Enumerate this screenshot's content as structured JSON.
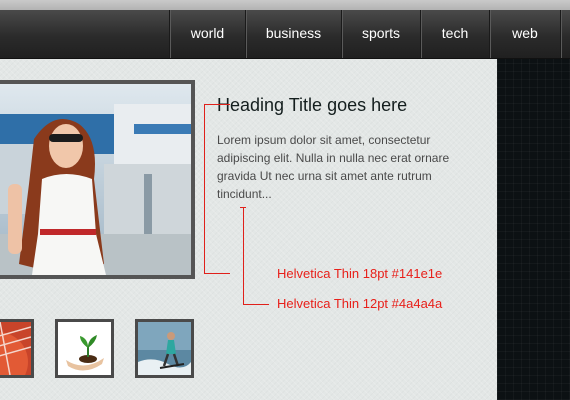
{
  "nav": {
    "items": [
      {
        "label": "world"
      },
      {
        "label": "business"
      },
      {
        "label": "sports"
      },
      {
        "label": "tech"
      },
      {
        "label": "web"
      },
      {
        "label": ""
      }
    ]
  },
  "article": {
    "heading": "Heading Title goes here",
    "body": "Lorem ipsum dolor sit amet, consectetur adipiscing elit. Nulla in nulla nec erat ornare gravida Ut nec urna sit amet ante rutrum tincidunt..."
  },
  "annotations": {
    "heading_spec": "Helvetica Thin 18pt #141e1e",
    "body_spec": "Helvetica Thin 12pt #4a4a4a"
  },
  "colors": {
    "heading": "#141e1e",
    "body": "#4a4a4a",
    "annotation": "#e8201a"
  }
}
